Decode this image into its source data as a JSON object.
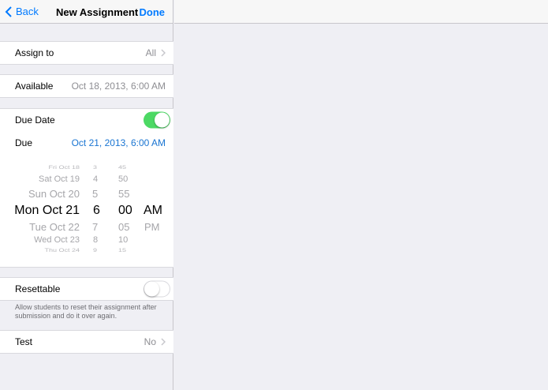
{
  "nav": {
    "back_label": "Back",
    "title": "New Assignment",
    "done_label": "Done"
  },
  "rows": {
    "assign_to": {
      "label": "Assign to",
      "value": "All"
    },
    "available": {
      "label": "Available",
      "value": "Oct 18, 2013, 6:00 AM"
    },
    "due_date": {
      "label": "Due Date",
      "toggle": "on"
    },
    "due": {
      "label": "Due",
      "value": "Oct 21, 2013, 6:00 AM"
    },
    "resettable": {
      "label": "Resettable",
      "toggle": "off"
    },
    "test": {
      "label": "Test",
      "value": "No"
    }
  },
  "picker": {
    "dates": [
      "Fri Oct 18",
      "Sat Oct 19",
      "Sun Oct 20",
      "Mon Oct 21",
      "Tue Oct 22",
      "Wed Oct 23",
      "Thu Oct 24"
    ],
    "hours": [
      "3",
      "4",
      "5",
      "6",
      "7",
      "8",
      "9"
    ],
    "minutes": [
      "45",
      "50",
      "55",
      "00",
      "05",
      "10",
      "15"
    ],
    "ampm": [
      "AM",
      "PM"
    ],
    "selected": {
      "date": "Mon Oct 21",
      "hour": "6",
      "minute": "00",
      "ampm": "AM"
    }
  },
  "resettable_note": "Allow students to reset their assignment after submission and do it over again.",
  "colors": {
    "accent": "#007aff",
    "toggle_on": "#4cd964",
    "background": "#efeff4"
  }
}
